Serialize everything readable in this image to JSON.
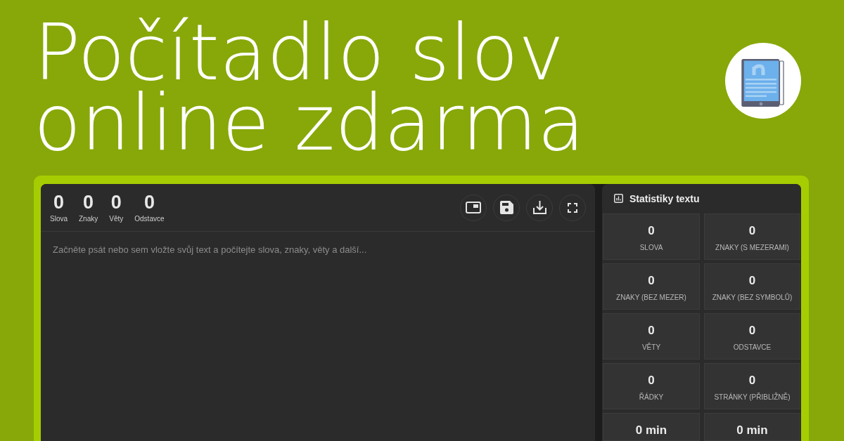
{
  "title": {
    "lines": [
      "Počítadlo slov",
      "online zdarma"
    ]
  },
  "editor": {
    "counters": [
      {
        "value": "0",
        "label": "Slova"
      },
      {
        "value": "0",
        "label": "Znaky"
      },
      {
        "value": "0",
        "label": "Věty"
      },
      {
        "value": "0",
        "label": "Odstavce"
      }
    ],
    "placeholder": "Začněte psát nebo sem vložte svůj text a počítejte slova, znaky, věty a další..."
  },
  "stats": {
    "title": "Statistiky textu",
    "items": [
      {
        "value": "0",
        "label": "SLOVA"
      },
      {
        "value": "0",
        "label": "ZNAKY (S MEZERAMI)"
      },
      {
        "value": "0",
        "label": "ZNAKY (BEZ MEZER)"
      },
      {
        "value": "0",
        "label": "ZNAKY (BEZ SYMBOLŮ)"
      },
      {
        "value": "0",
        "label": "VĚTY"
      },
      {
        "value": "0",
        "label": "ODSTAVCE"
      },
      {
        "value": "0",
        "label": "ŘÁDKY"
      },
      {
        "value": "0",
        "label": "STRÁNKY (PŘIBLIŽNĚ)"
      },
      {
        "value": "0 min"
      },
      {
        "value": "0 min"
      }
    ]
  }
}
